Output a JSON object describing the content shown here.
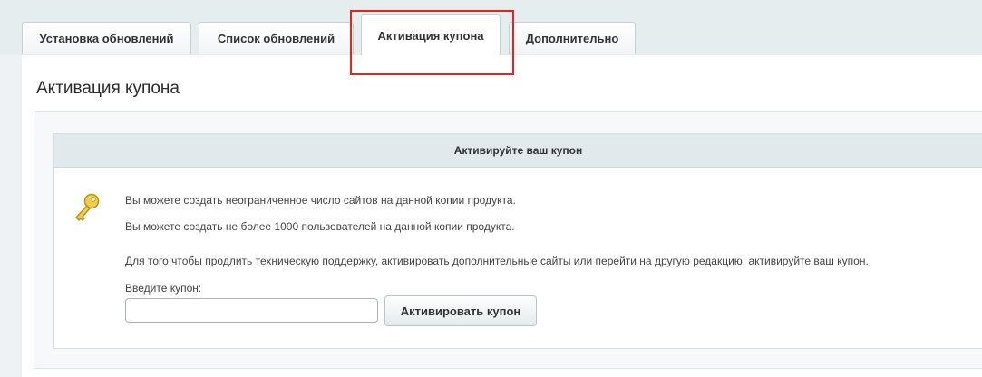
{
  "tabs": [
    {
      "label": "Установка обновлений"
    },
    {
      "label": "Список обновлений"
    },
    {
      "label": "Активация купона"
    },
    {
      "label": "Дополнительно"
    }
  ],
  "active_tab": "Активация купона",
  "page": {
    "title": "Активация купона"
  },
  "card": {
    "header": "Активируйте ваш купон",
    "icon": "key-icon",
    "lines": [
      "Вы можете создать неограниченное число сайтов на данной копии продукта.",
      "Вы можете создать не более 1000 пользователей на данной копии продукта.",
      "Для того чтобы продлить техническую поддержку, активировать дополнительные сайты или перейти на другую редакцию, активируйте ваш купон."
    ],
    "coupon_label": "Введите купон:",
    "coupon_value": "",
    "activate_button": "Активировать купон"
  },
  "colors": {
    "highlight": "#e8231f",
    "tabbar_bg": "#e6edef",
    "card_header_bg": "#e2e9ec",
    "key_icon": "#e8c23a"
  }
}
